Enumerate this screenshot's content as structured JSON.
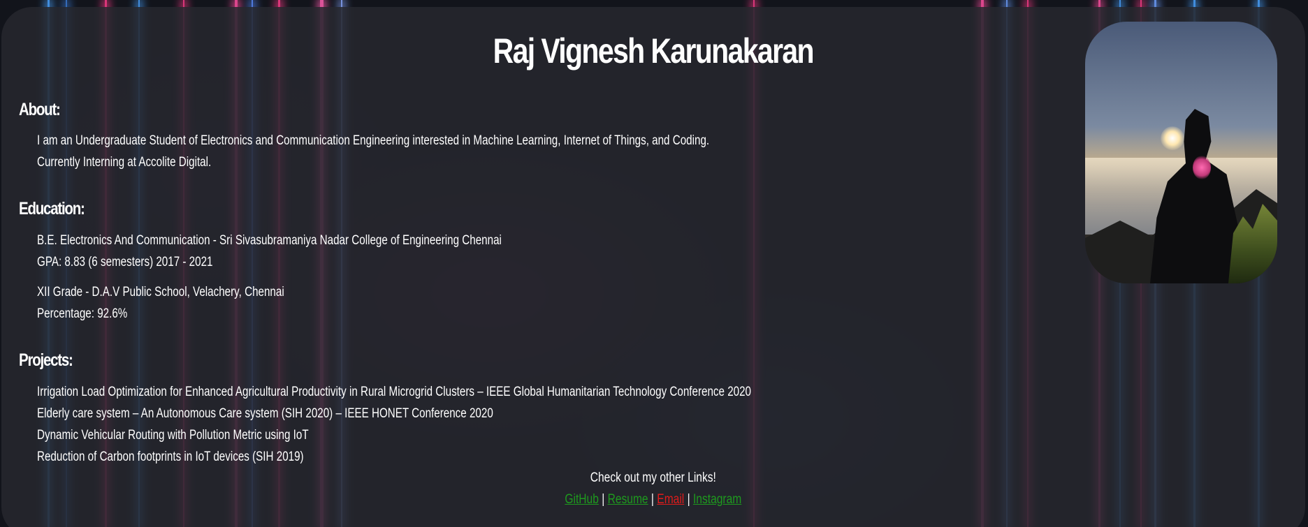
{
  "profile": {
    "name": "Raj Vignesh Karunakaran",
    "photo_alt": "Person silhouetted against sunrise above clouds"
  },
  "about": {
    "heading": "About:",
    "lines": [
      "I am an Undergraduate Student of Electronics and Communication Engineering interested in Machine Learning, Internet of Things, and Coding.",
      "Currently Interning at Accolite Digital."
    ]
  },
  "education": {
    "heading": "Education:",
    "entries": [
      {
        "line1": "B.E. Electronics And Communication - Sri Sivasubramaniya Nadar College of Engineering Chennai",
        "line2": "GPA: 8.83 (6 semesters) 2017 - 2021"
      },
      {
        "line1": "XII Grade - D.A.V Public School, Velachery, Chennai",
        "line2": "Percentage: 92.6%"
      }
    ]
  },
  "projects": {
    "heading": "Projects:",
    "items": [
      "Irrigation Load Optimization for Enhanced Agricultural Productivity in Rural Microgrid Clusters – IEEE Global Humanitarian Technology Conference 2020",
      "Elderly care system – An Autonomous Care system (SIH 2020) – IEEE HONET Conference 2020",
      "Dynamic Vehicular Routing with Pollution Metric using IoT",
      "Reduction of Carbon footprints in IoT devices (SIH 2019)"
    ]
  },
  "footer": {
    "links_title": "Check out my other Links!",
    "separator": "|",
    "links": [
      {
        "label": "GitHub",
        "color": "#1e9a1e"
      },
      {
        "label": "Resume",
        "color": "#1e9a1e"
      },
      {
        "label": "Email",
        "color": "#e01b1b"
      },
      {
        "label": "Instagram",
        "color": "#1e9a1e"
      }
    ]
  },
  "colors": {
    "card_background": "#26282e",
    "text": "#ffffff",
    "link_green": "#1e9a1e",
    "link_red": "#e01b1b"
  }
}
